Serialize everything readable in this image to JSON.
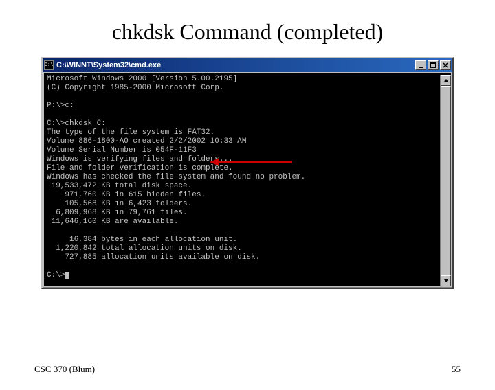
{
  "slide": {
    "title": "chkdsk Command (completed)",
    "footer_left": "CSC 370 (Blum)",
    "page_number": "55"
  },
  "window": {
    "icon_text": "C:\\",
    "title": "C:\\WINNT\\System32\\cmd.exe",
    "btn_min_glyph": "_",
    "btn_max_glyph": "□",
    "btn_close_glyph": "×"
  },
  "terminal": {
    "lines": [
      "Microsoft Windows 2000 [Version 5.00.2195]",
      "(C) Copyright 1985-2000 Microsoft Corp.",
      "",
      "P:\\>c:",
      "",
      "C:\\>chkdsk C:",
      "The type of the file system is FAT32.",
      "Volume 886-1800-A0 created 2/2/2002 10:33 AM",
      "Volume Serial Number is 054F-11F3",
      "Windows is verifying files and folders...",
      "File and folder verification is complete.",
      "Windows has checked the file system and found no problem.",
      " 19,533,472 KB total disk space.",
      "    971,760 KB in 615 hidden files.",
      "    105,568 KB in 6,423 folders.",
      "  6,809,968 KB in 79,761 files.",
      " 11,646,160 KB are available.",
      "",
      "     16,384 bytes in each allocation unit.",
      "  1,220,842 total allocation units on disk.",
      "    727,885 allocation units available on disk.",
      "",
      "C:\\>"
    ]
  }
}
